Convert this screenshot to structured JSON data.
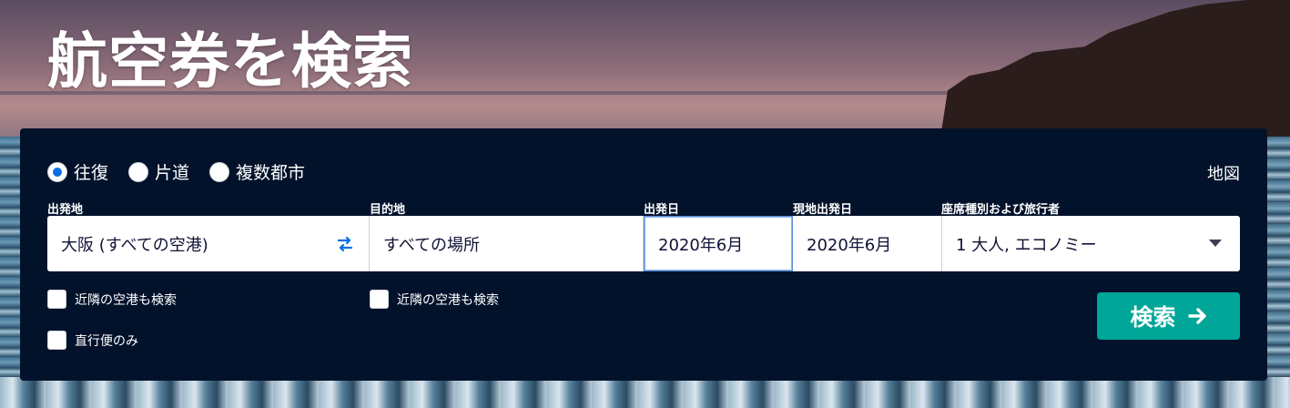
{
  "hero": {
    "title": "航空券を検索"
  },
  "trip_types": [
    {
      "label": "往復",
      "checked": true
    },
    {
      "label": "片道",
      "checked": false
    },
    {
      "label": "複数都市",
      "checked": false
    }
  ],
  "map_link": "地図",
  "labels": {
    "origin": "出発地",
    "destination": "目的地",
    "depart": "出発日",
    "return": "現地出発日",
    "cabin": "座席種別および旅行者"
  },
  "values": {
    "origin": "大阪 (すべての空港)",
    "destination": "すべての場所",
    "depart": "2020年6月",
    "return": "2020年6月",
    "cabin": "1 大人, エコノミー"
  },
  "checkboxes": {
    "origin_nearby": "近隣の空港も検索",
    "destination_nearby": "近隣の空港も検索",
    "direct_only": "直行便のみ"
  },
  "search_button": "検索",
  "colors": {
    "panel": "#02122b",
    "accent": "#0770e3",
    "search_button": "#00a698"
  }
}
